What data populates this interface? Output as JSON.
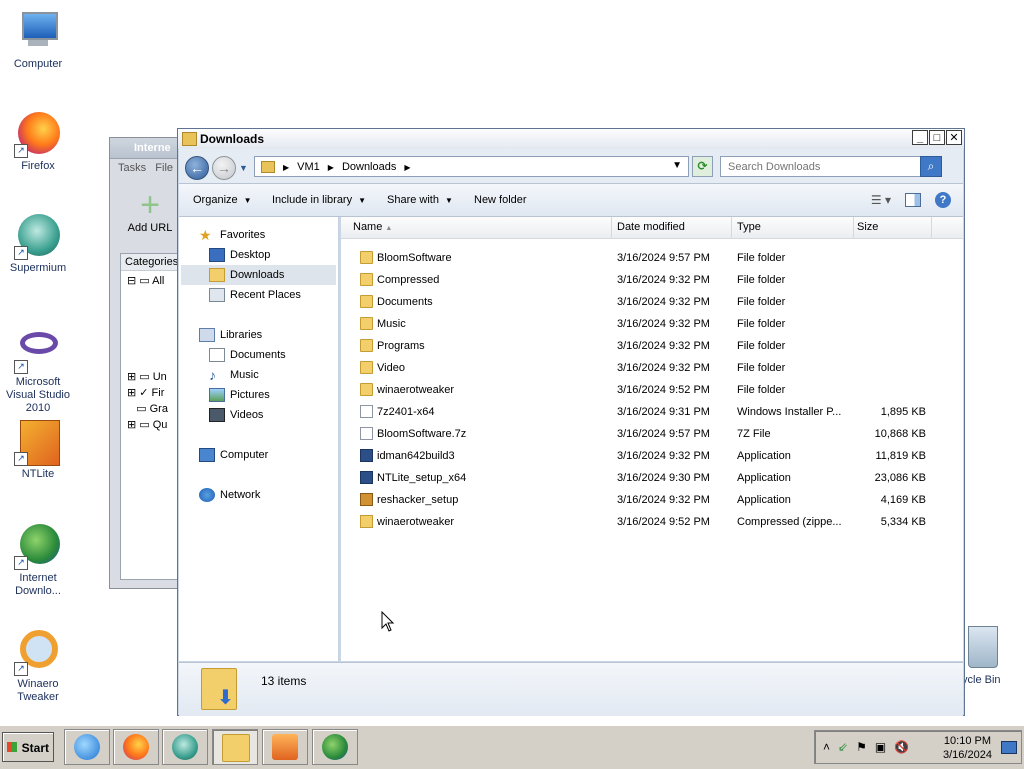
{
  "desktop": {
    "icons": [
      {
        "label": "Computer"
      },
      {
        "label": "Firefox"
      },
      {
        "label": "Supermium"
      },
      {
        "label": "Microsoft Visual Studio 2010"
      },
      {
        "label": "NTLite"
      },
      {
        "label": "Internet Downlo..."
      },
      {
        "label": "Winaero Tweaker"
      }
    ],
    "recycle_bin_label": "ycle Bin"
  },
  "background_window": {
    "title": "Interne",
    "menu_tasks": "Tasks",
    "menu_file": "File",
    "add_url": "Add URL",
    "categories_header": "Categories",
    "tree_items": [
      "All",
      "Un",
      "Fir",
      "Gra",
      "Qu"
    ]
  },
  "window": {
    "title": "Downloads",
    "breadcrumb": [
      "VM1",
      "Downloads"
    ],
    "search_placeholder": "Search Downloads",
    "toolbar": {
      "organize": "Organize",
      "include_in_library": "Include in library",
      "share_with": "Share with",
      "new_folder": "New folder"
    },
    "nav": {
      "favorites": "Favorites",
      "desktop": "Desktop",
      "downloads": "Downloads",
      "recent_places": "Recent Places",
      "libraries": "Libraries",
      "documents": "Documents",
      "music": "Music",
      "pictures": "Pictures",
      "videos": "Videos",
      "computer": "Computer",
      "network": "Network"
    },
    "columns": {
      "name": "Name",
      "date": "Date modified",
      "type": "Type",
      "size": "Size"
    },
    "files": [
      {
        "name": "BloomSoftware",
        "date": "3/16/2024 9:57 PM",
        "type": "File folder",
        "size": ""
      },
      {
        "name": "Compressed",
        "date": "3/16/2024 9:32 PM",
        "type": "File folder",
        "size": ""
      },
      {
        "name": "Documents",
        "date": "3/16/2024 9:32 PM",
        "type": "File folder",
        "size": ""
      },
      {
        "name": "Music",
        "date": "3/16/2024 9:32 PM",
        "type": "File folder",
        "size": ""
      },
      {
        "name": "Programs",
        "date": "3/16/2024 9:32 PM",
        "type": "File folder",
        "size": ""
      },
      {
        "name": "Video",
        "date": "3/16/2024 9:32 PM",
        "type": "File folder",
        "size": ""
      },
      {
        "name": "winaerotweaker",
        "date": "3/16/2024 9:52 PM",
        "type": "File folder",
        "size": ""
      },
      {
        "name": "7z2401-x64",
        "date": "3/16/2024 9:31 PM",
        "type": "Windows Installer P...",
        "size": "1,895 KB"
      },
      {
        "name": "BloomSoftware.7z",
        "date": "3/16/2024 9:57 PM",
        "type": "7Z File",
        "size": "10,868 KB"
      },
      {
        "name": "idman642build3",
        "date": "3/16/2024 9:32 PM",
        "type": "Application",
        "size": "11,819 KB"
      },
      {
        "name": "NTLite_setup_x64",
        "date": "3/16/2024 9:30 PM",
        "type": "Application",
        "size": "23,086 KB"
      },
      {
        "name": "reshacker_setup",
        "date": "3/16/2024 9:32 PM",
        "type": "Application",
        "size": "4,169 KB"
      },
      {
        "name": "winaerotweaker",
        "date": "3/16/2024 9:52 PM",
        "type": "Compressed (zippe...",
        "size": "5,334 KB"
      }
    ],
    "item_count": "13 items"
  },
  "taskbar": {
    "start_label": "Start",
    "clock_time": "10:10 PM",
    "clock_date": "3/16/2024"
  }
}
